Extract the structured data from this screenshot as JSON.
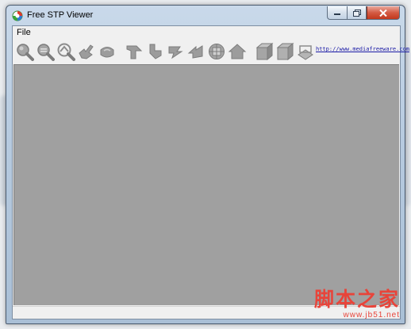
{
  "window": {
    "title": "Free STP Viewer"
  },
  "menu": {
    "file_label": "File"
  },
  "toolbar": {
    "buttons": [
      {
        "icon": "zoom-in-icon"
      },
      {
        "icon": "zoom-out-icon"
      },
      {
        "icon": "zoom-window-icon"
      },
      {
        "icon": "pan-icon"
      },
      {
        "icon": "rotate-icon"
      },
      {
        "icon": "view-front-icon"
      },
      {
        "icon": "view-back-icon"
      },
      {
        "icon": "view-left-icon"
      },
      {
        "icon": "view-right-icon"
      },
      {
        "icon": "fit-all-icon"
      },
      {
        "icon": "home-view-icon"
      },
      {
        "icon": "shaded-cube-icon"
      },
      {
        "icon": "wireframe-cube-icon"
      },
      {
        "icon": "top-plane-icon"
      }
    ],
    "link_text": "http://www.mediafreeware.com"
  },
  "watermark": {
    "main": "脚本之家",
    "sub": "www.jb51.net"
  },
  "colors": {
    "viewport": "#a0a0a0",
    "icon_gray": "#8c8c8c",
    "link": "#1a1aa6",
    "watermark": "#e8443a"
  }
}
